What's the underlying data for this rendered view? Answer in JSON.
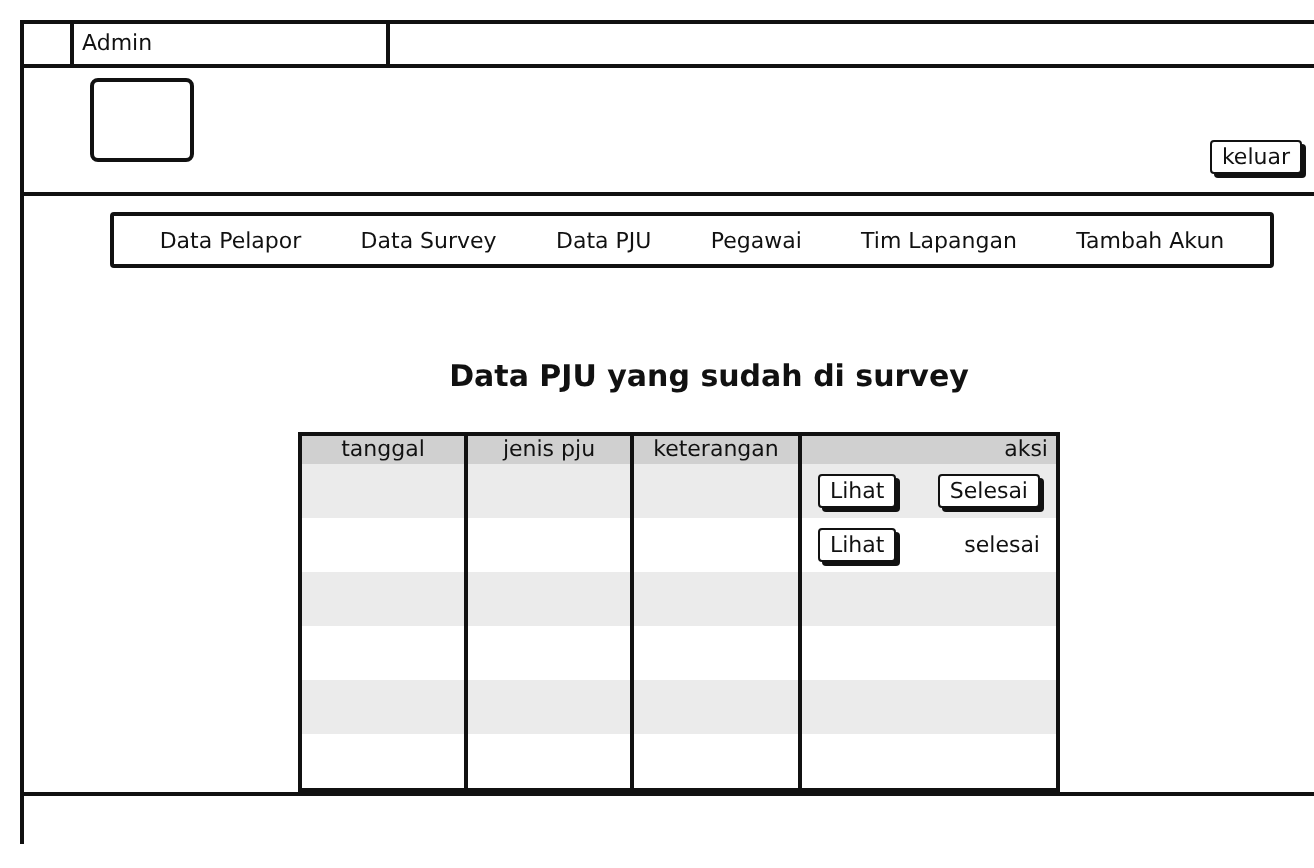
{
  "window": {
    "title": "Admin"
  },
  "header": {
    "logout_button": "keluar"
  },
  "nav": {
    "items": [
      {
        "label": "Data Pelapor"
      },
      {
        "label": "Data Survey"
      },
      {
        "label": "Data PJU"
      },
      {
        "label": "Pegawai"
      },
      {
        "label": "Tim Lapangan"
      },
      {
        "label": "Tambah Akun"
      }
    ]
  },
  "heading": "Data PJU yang sudah di survey",
  "table": {
    "columns": [
      "tanggal",
      "jenis pju",
      "keterangan",
      "aksi"
    ],
    "rows": [
      {
        "aksi": [
          {
            "kind": "button",
            "label": "Lihat"
          },
          {
            "kind": "button",
            "label": "Selesai"
          }
        ]
      },
      {
        "aksi": [
          {
            "kind": "button",
            "label": "Lihat"
          },
          {
            "kind": "text",
            "label": "selesai"
          }
        ]
      },
      {},
      {},
      {},
      {}
    ]
  }
}
